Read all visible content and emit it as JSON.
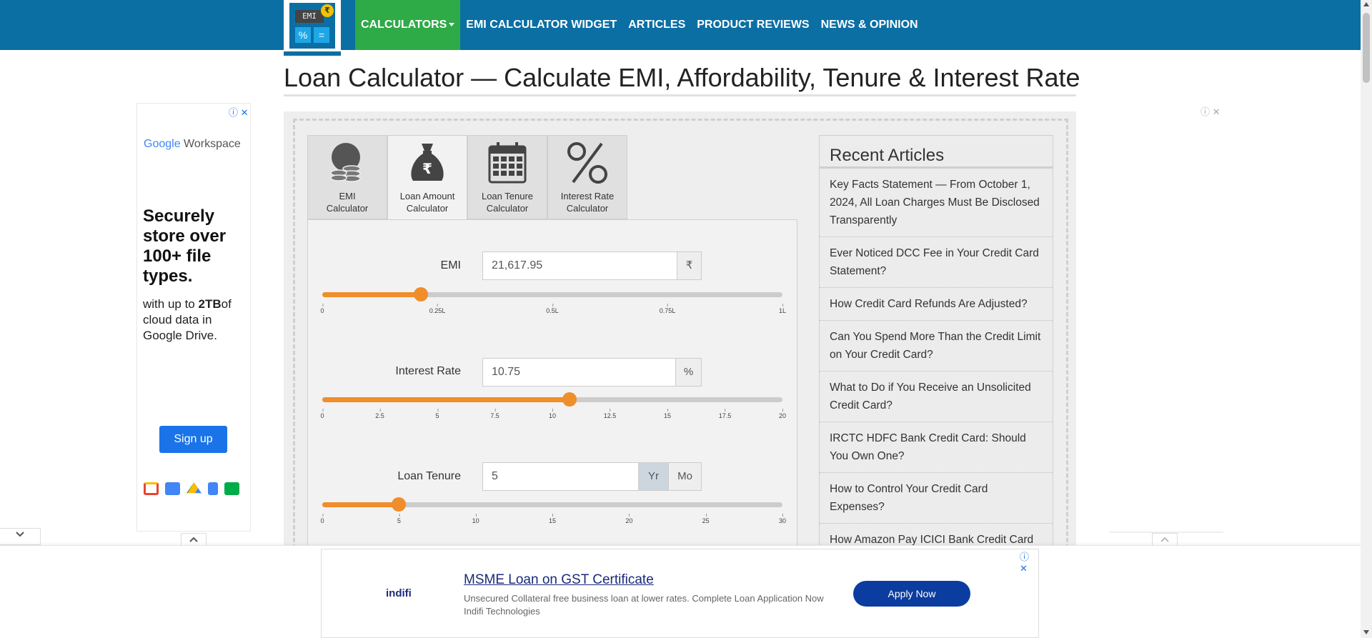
{
  "header": {
    "logo_text": "EMI",
    "logo_coin": "₹",
    "logo_keys": [
      "%",
      "="
    ],
    "nav": [
      {
        "label": "CALCULATORS",
        "active": true
      },
      {
        "label": "EMI CALCULATOR WIDGET",
        "active": false
      },
      {
        "label": "ARTICLES",
        "active": false
      },
      {
        "label": "PRODUCT REVIEWS",
        "active": false
      },
      {
        "label": "NEWS & OPINION",
        "active": false
      }
    ]
  },
  "page_title": "Loan Calculator — Calculate EMI, Affordability, Tenure & Interest Rate",
  "tabs": [
    {
      "line1": "EMI",
      "line2": "Calculator",
      "icon": "coins-icon"
    },
    {
      "line1": "Loan Amount",
      "line2": "Calculator",
      "icon": "money-bag-icon"
    },
    {
      "line1": "Loan Tenure",
      "line2": "Calculator",
      "icon": "calendar-icon"
    },
    {
      "line1": "Interest Rate",
      "line2": "Calculator",
      "icon": "percent-icon"
    }
  ],
  "active_tab": 1,
  "fields": {
    "emi": {
      "label": "EMI",
      "value": "21,617.95",
      "unit": "₹",
      "slider_fraction": 0.215,
      "ticks": [
        "0",
        "0.25L",
        "0.5L",
        "0.75L",
        "1L"
      ]
    },
    "interest": {
      "label": "Interest Rate",
      "value": "10.75",
      "unit": "%",
      "slider_fraction": 0.5375,
      "ticks": [
        "0",
        "2.5",
        "5",
        "7.5",
        "10",
        "12.5",
        "15",
        "17.5",
        "20"
      ]
    },
    "tenure": {
      "label": "Loan Tenure",
      "value": "5",
      "unit_yr": "Yr",
      "unit_mo": "Mo",
      "selected_unit": "Yr",
      "slider_fraction": 0.1667,
      "ticks": [
        "0",
        "5",
        "10",
        "15",
        "20",
        "25",
        "30"
      ]
    }
  },
  "recent_articles": {
    "title": "Recent Articles",
    "items": [
      "Key Facts Statement — From October 1, 2024, All Loan Charges Must Be Disclosed Transparently",
      "Ever Noticed DCC Fee in Your Credit Card Statement?",
      "How Credit Card Refunds Are Adjusted?",
      "Can You Spend More Than the Credit Limit on Your Credit Card?",
      "What to Do if You Receive an Unsolicited Credit Card?",
      "IRCTC HDFC Bank Credit Card: Should You Own One?",
      "How to Control Your Credit Card Expenses?",
      "How Amazon Pay ICICI Bank Credit Card"
    ]
  },
  "left_ad": {
    "brand_google": "Google",
    "brand_product": "Workspace",
    "headline": "Securely store over 100+ file types.",
    "sub_pre": "with up to ",
    "sub_bold": "2TB",
    "sub_post": "of cloud data in Google Drive.",
    "button": "Sign up",
    "close_icons": "ⓘ ✕"
  },
  "right_ad": {
    "close_icons": "ⓘ ✕"
  },
  "bottom_ad": {
    "advertiser": "indifi",
    "title": "MSME Loan on GST Certificate",
    "description": "Unsecured Collateral free business loan at lower rates. Complete Loan Application Now Indifi Technologies",
    "button": "Apply Now",
    "close_icons": "ⓘ ✕"
  },
  "colors": {
    "header_bg": "#0b6fa4",
    "nav_active": "#2eaa47",
    "slider": "#ef8e2b",
    "ad_button": "#1a73e8",
    "bottom_ad_button": "#0b3ca0"
  }
}
